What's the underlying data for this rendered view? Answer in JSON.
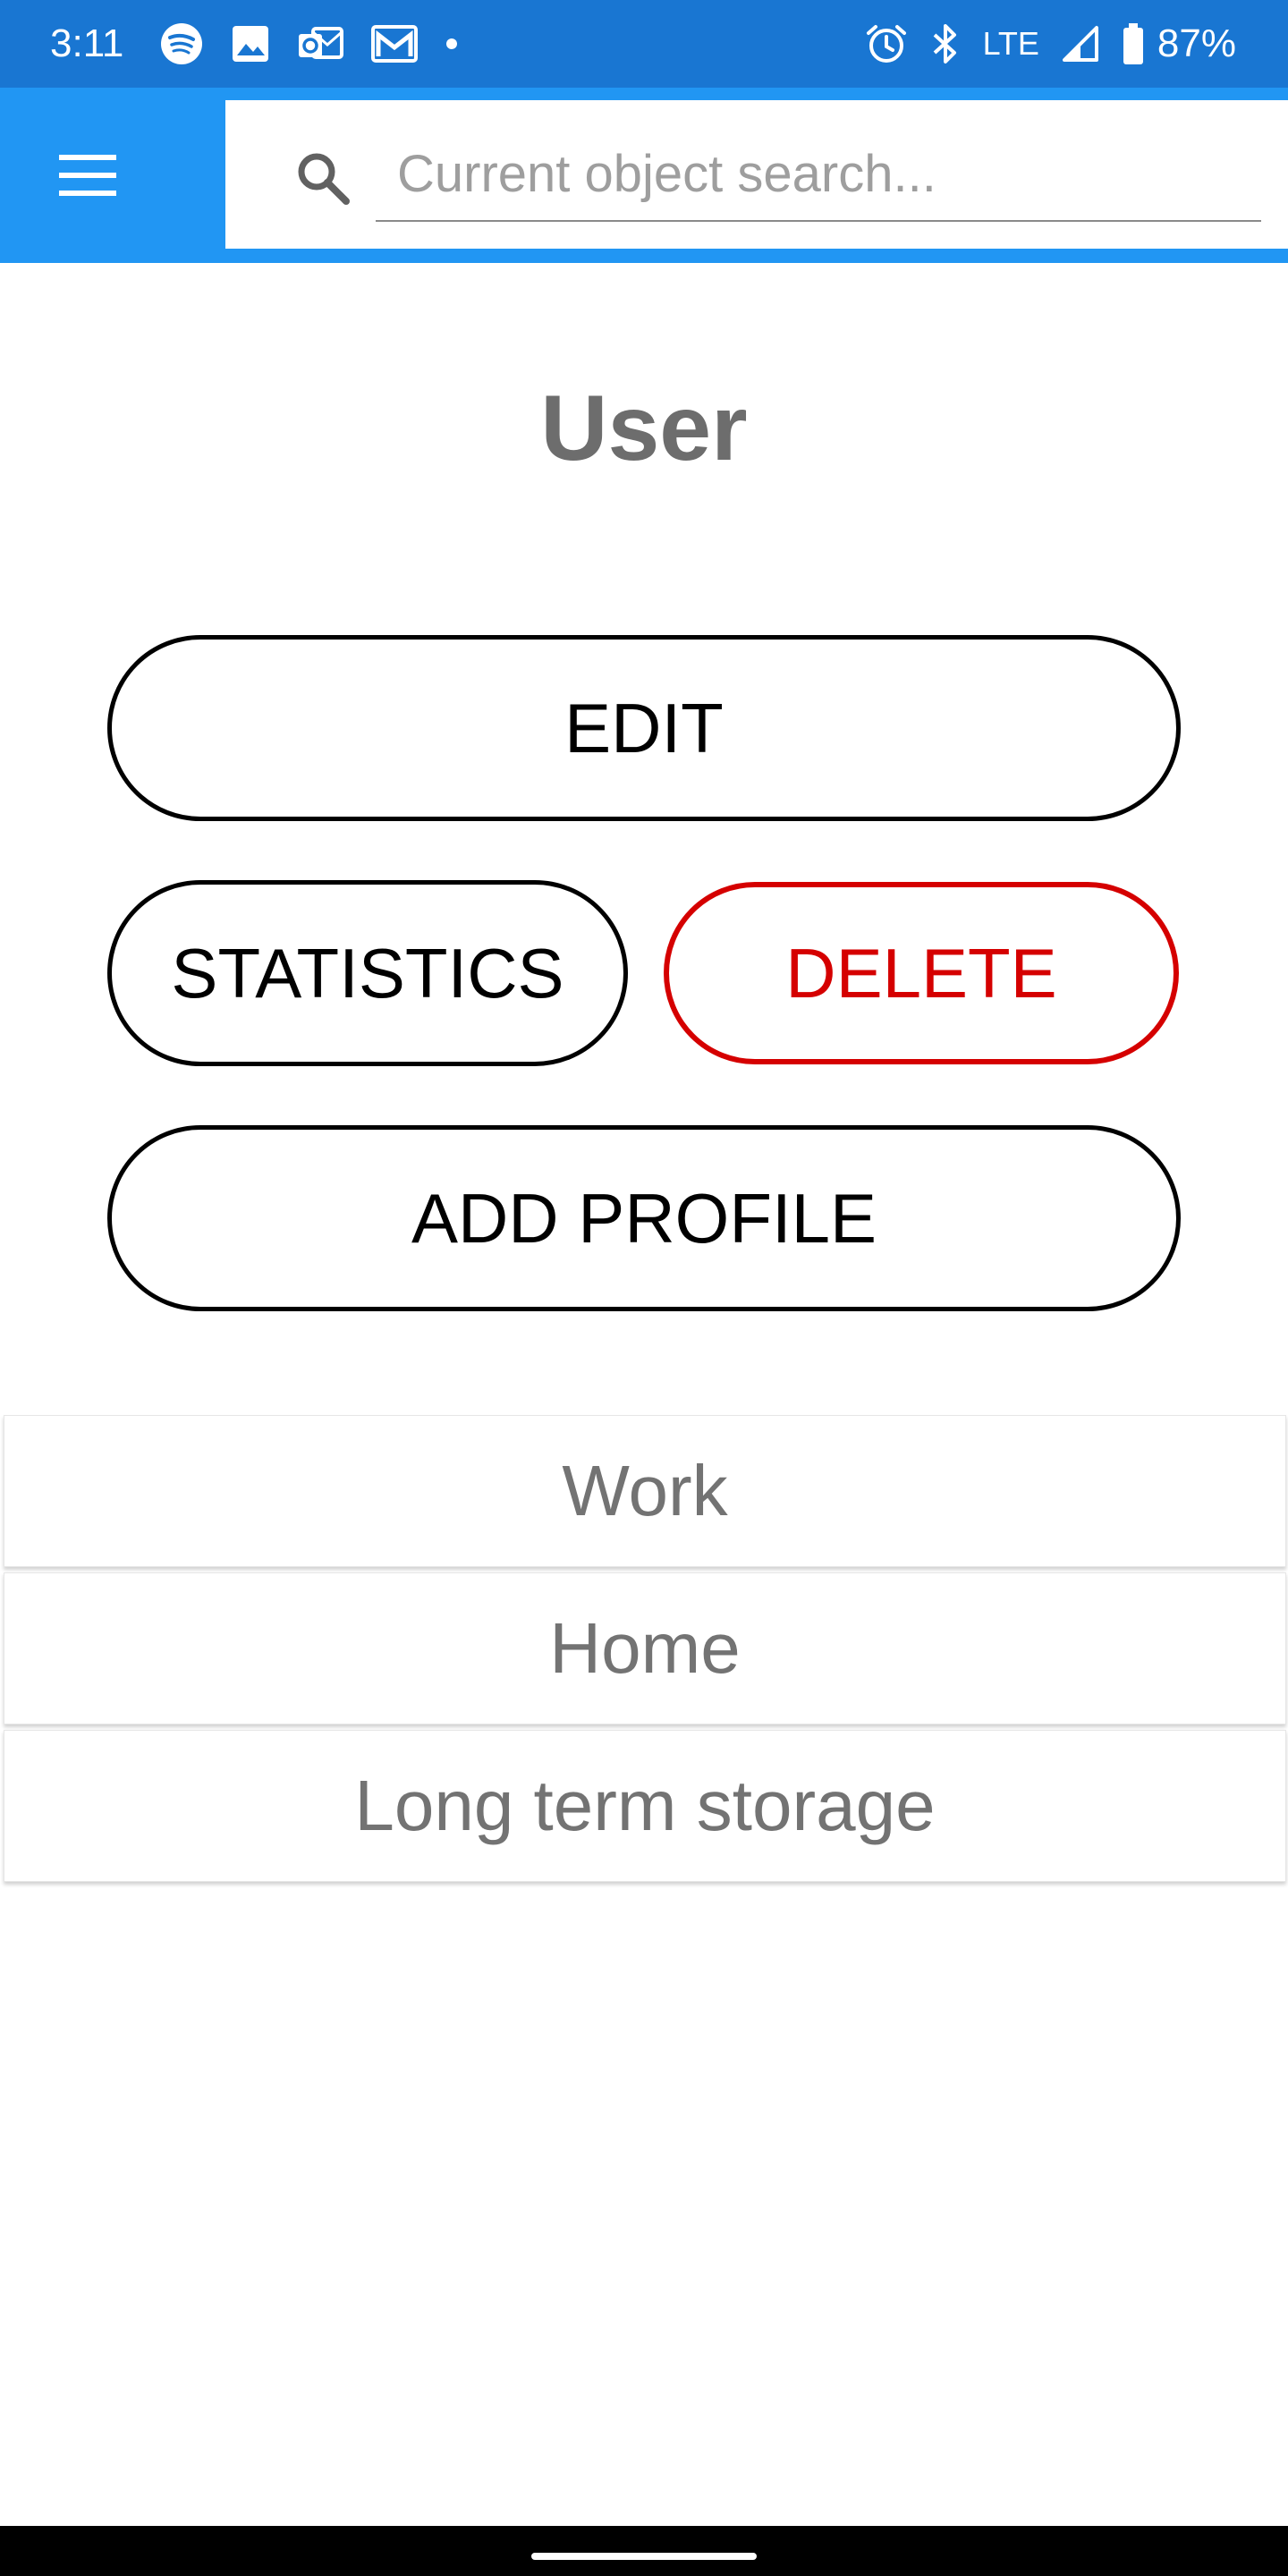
{
  "status_bar": {
    "time": "3:11",
    "network": "LTE",
    "battery": "87%",
    "notification_icons": [
      "spotify-icon",
      "image-icon",
      "outlook-icon",
      "gmail-icon",
      "dot-icon"
    ],
    "system_icons": [
      "alarm-icon",
      "bluetooth-icon",
      "signal-icon",
      "battery-icon"
    ]
  },
  "app_bar": {
    "color": "#2196f3",
    "status_color": "#1976d2",
    "menu_icon": "hamburger-menu-icon",
    "search": {
      "icon": "search-icon",
      "value": "",
      "placeholder": "Current object search..."
    }
  },
  "main": {
    "title": "User",
    "buttons": {
      "edit": "EDIT",
      "statistics": "STATISTICS",
      "delete": "DELETE",
      "add_profile": "ADD PROFILE"
    },
    "delete_color": "#d50000",
    "profiles": [
      {
        "label": "Work"
      },
      {
        "label": "Home"
      },
      {
        "label": "Long term storage"
      }
    ]
  }
}
